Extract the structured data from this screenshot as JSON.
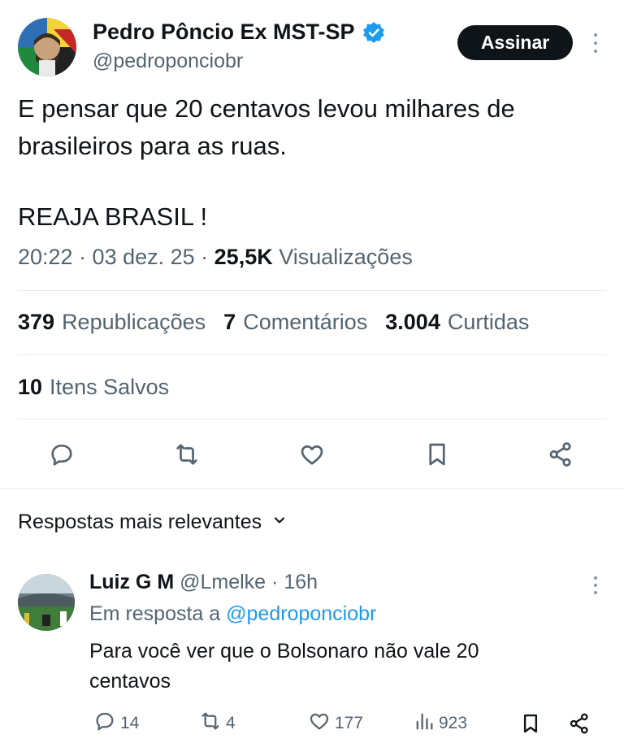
{
  "post": {
    "author_name": "Pedro Pôncio Ex MST-SP",
    "author_handle": "@pedroponciobr",
    "subscribe_label": "Assinar",
    "text_line1": "E pensar que 20 centavos levou milhares de",
    "text_line2": "brasileiros para as ruas.",
    "text_line3": "REAJA BRASIL !",
    "time": "20:22 · 03 dez. 25 · ",
    "views_count": "25,5K",
    "views_label": "Visualizações"
  },
  "stats": {
    "reposts_count": "379",
    "reposts_label": "Republicações",
    "comments_count": "7",
    "comments_label": "Comentários",
    "likes_count": "3.004",
    "likes_label": "Curtidas",
    "saved_count": "10",
    "saved_label": "Itens Salvos"
  },
  "replies_sort": "Respostas mais relevantes",
  "reply": {
    "author_name": "Luiz G M",
    "author_handle": "@Lmelke",
    "time": "· 16h",
    "reply_to_label": "Em resposta a",
    "reply_to_handle": "@pedroponciobr",
    "text_line1": "Para você ver que o Bolsonaro não vale 20",
    "text_line2": "centavos",
    "comments": "14",
    "reposts": "4",
    "likes": "177",
    "views": "923"
  },
  "colors": {
    "accent": "#1d9bf0",
    "text": "#0f1419",
    "muted": "#536471",
    "divider": "#e6e9ec"
  },
  "icons": [
    "verified-badge-icon",
    "more-icon",
    "reply-icon",
    "repost-icon",
    "like-icon",
    "bookmark-icon",
    "share-icon",
    "chevron-down-icon",
    "views-icon"
  ]
}
